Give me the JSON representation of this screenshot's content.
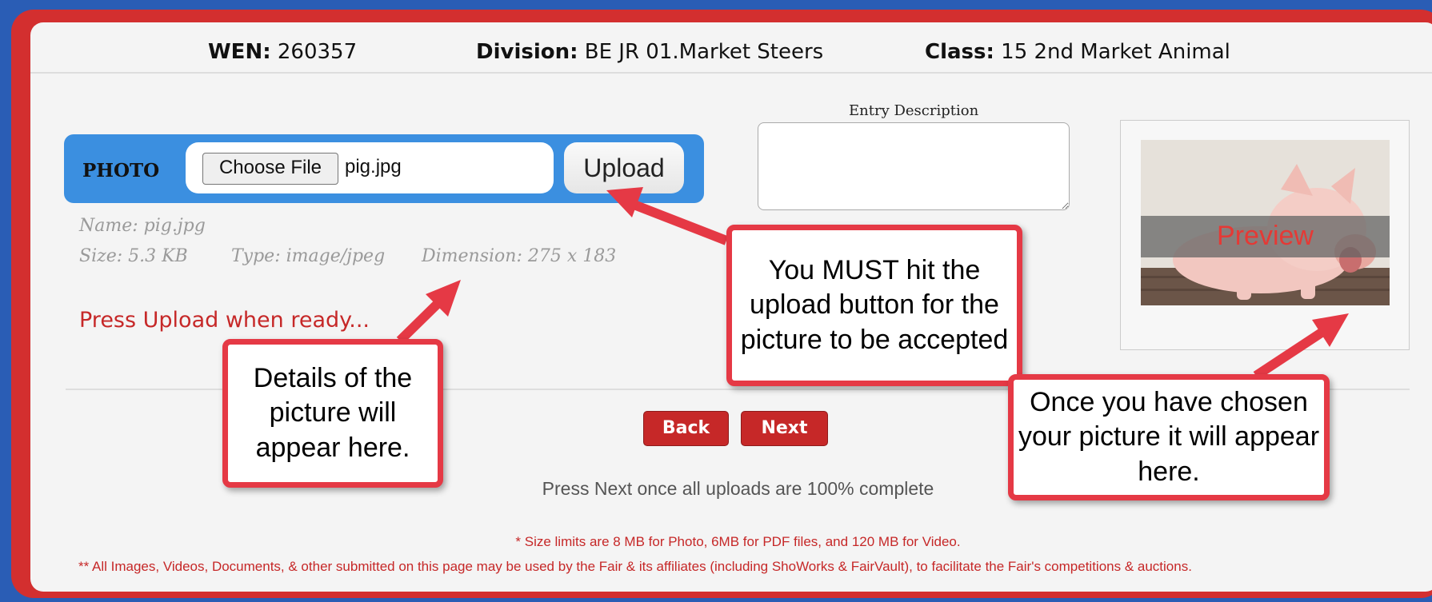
{
  "header": {
    "wen_label": "WEN:",
    "wen_value": "260357",
    "division_label": "Division:",
    "division_value": "BE JR 01.Market Steers",
    "class_label": "Class:",
    "class_value": "15 2nd Market Animal"
  },
  "photo": {
    "label": "PHOTO",
    "choose_file_label": "Choose File",
    "file_name": "pig.jpg",
    "upload_label": "Upload"
  },
  "file_details": {
    "name": "Name: pig.jpg",
    "size": "Size: 5.3 KB",
    "type": "Type: image/jpeg",
    "dimension": "Dimension: 275 x 183"
  },
  "status_text": "Press Upload when ready...",
  "entry_description": {
    "label": "Entry Description",
    "value": ""
  },
  "preview": {
    "label": "Preview"
  },
  "nav": {
    "back_label": "Back",
    "next_label": "Next"
  },
  "press_next_text": "Press Next once all uploads are 100% complete",
  "footnotes": {
    "size_limits": "* Size limits are 8 MB for Photo, 6MB for PDF files, and 120 MB for Video.",
    "usage": "** All Images, Videos, Documents, & other submitted on this page may be used by the Fair & its affiliates (including ShoWorks & FairVault), to facilitate the Fair's competitions & auctions."
  },
  "callouts": {
    "details": "Details of the picture will appear here.",
    "upload": "You MUST hit the upload button for the picture to be accepted",
    "preview": "Once you have chosen your picture it will appear here."
  },
  "colors": {
    "frame_red": "#d32f2f",
    "photo_bar_blue": "#3b8fe0",
    "button_red": "#c62828",
    "callout_border": "#e53945"
  }
}
